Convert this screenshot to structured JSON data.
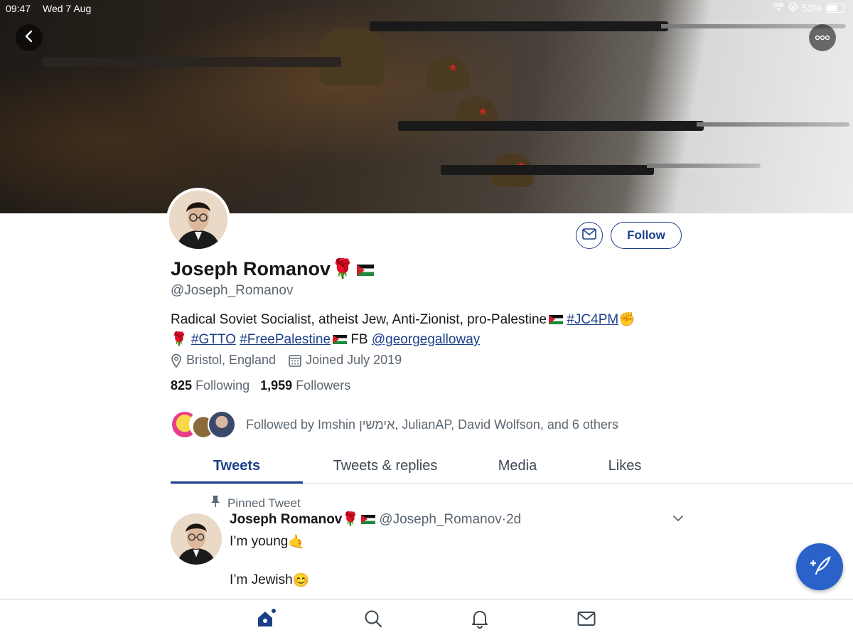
{
  "status_bar": {
    "time": "09:47",
    "date": "Wed 7 Aug",
    "battery": "53%",
    "battery_level": 0.53
  },
  "profile": {
    "display_name": "Joseph Romanov",
    "handle": "@Joseph_Romanov",
    "follow_label": "Follow",
    "bio": {
      "text1": "Radical Soviet Socialist, atheist Jew, Anti-Zionist, pro-Palestine",
      "tag_jc4pm": "#JC4PM",
      "tag_gtto": "#GTTO",
      "tag_freepalestine": "#FreePalestine",
      "fb_text": "FB",
      "mention": "@georgegalloway"
    },
    "location": "Bristol, England",
    "joined": "Joined July 2019",
    "following_count": "825",
    "following_label": "Following",
    "followers_count": "1,959",
    "followers_label": "Followers",
    "followed_by": "Followed by Imshin אימשין, JulianAP, David Wolfson, and 6 others"
  },
  "tabs": [
    {
      "label": "Tweets",
      "active": true
    },
    {
      "label": "Tweets & replies",
      "active": false
    },
    {
      "label": "Media",
      "active": false
    },
    {
      "label": "Likes",
      "active": false
    }
  ],
  "pinned_tweet": {
    "label": "Pinned Tweet",
    "author": "Joseph Romanov",
    "handle": "@Joseph_Romanov",
    "separator": "·",
    "time": "2d",
    "line1": "I’m young",
    "line2": "I’m Jewish"
  },
  "icons": {
    "back": "chevron-left-icon",
    "more": "more-icon",
    "message": "envelope-icon",
    "location": "location-pin-icon",
    "calendar": "calendar-icon",
    "pin": "pin-icon",
    "compose": "compose-icon",
    "nav": [
      "home-icon",
      "search-icon",
      "bell-icon",
      "mail-icon"
    ]
  },
  "colors": {
    "accent": "#1d3f8a",
    "fab": "#2a62c9",
    "text": "#14171a",
    "muted": "#5b6670"
  }
}
